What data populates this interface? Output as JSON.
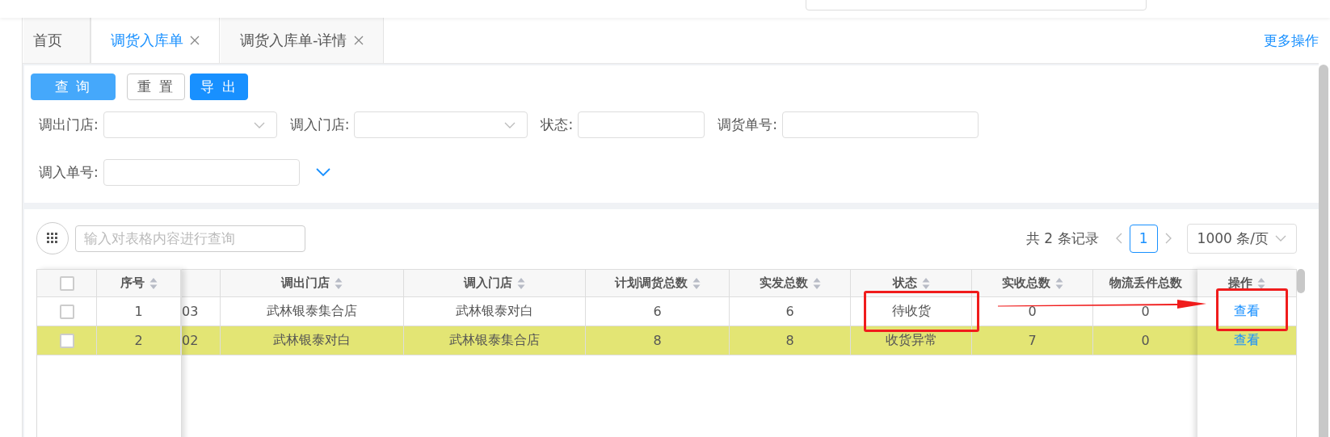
{
  "tabs": [
    {
      "label": "首页",
      "selected": false,
      "closable": false
    },
    {
      "label": "调货入库单",
      "selected": true,
      "closable": true
    },
    {
      "label": "调货入库单-详情",
      "selected": false,
      "closable": true
    }
  ],
  "more_actions": "更多操作",
  "buttons": [
    {
      "label": "查 询",
      "kind": "primary"
    },
    {
      "label": "重 置",
      "kind": "default"
    },
    {
      "label": "导 出",
      "kind": "strong"
    }
  ],
  "filters": [
    {
      "label": "调出门店:",
      "kind": "select"
    },
    {
      "label": "调入门店:",
      "kind": "select"
    },
    {
      "label": "状态:",
      "kind": "input"
    },
    {
      "label": "调货单号:",
      "kind": "input"
    },
    {
      "label": "调入单号:",
      "kind": "input"
    }
  ],
  "table_search": {
    "placeholder": "输入对表格内容进行查询"
  },
  "pagination": {
    "total": "共 2 条记录",
    "page": "1",
    "page_size": "1000 条/页"
  },
  "header_checkbox": {
    "checked": false
  },
  "columns": [
    {
      "label": "序号",
      "sortable": true
    },
    {
      "label": "调出门店",
      "sortable": true
    },
    {
      "label": "调入门店",
      "sortable": true
    },
    {
      "label": "计划调货总数",
      "sortable": true
    },
    {
      "label": "实发总数",
      "sortable": true
    },
    {
      "label": "状态",
      "sortable": true
    },
    {
      "label": "实收总数",
      "sortable": true
    },
    {
      "label": "物流丢件总数",
      "sortable": false
    },
    {
      "label": "操作",
      "sortable": true
    }
  ],
  "rows": [
    {
      "selected": false,
      "checked": false,
      "cells": [
        "1",
        "03",
        "武林银泰集合店",
        "武林银泰对白",
        "6",
        "6",
        "待收货",
        "0",
        "0"
      ],
      "action": "查看"
    },
    {
      "selected": true,
      "checked": false,
      "cells": [
        "2",
        "02",
        "武林银泰对白",
        "武林银泰集合店",
        "8",
        "8",
        "收货异常",
        "7",
        "0"
      ],
      "action": "查看"
    }
  ]
}
